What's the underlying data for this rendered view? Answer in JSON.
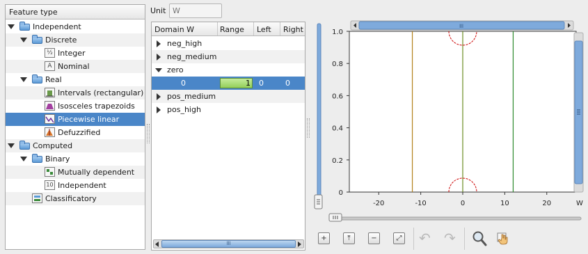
{
  "unit": {
    "label": "Unit",
    "placeholder": "W"
  },
  "tree": {
    "header": "Feature type",
    "items": [
      {
        "label": "Independent",
        "icon": "folder-icon"
      },
      {
        "label": "Discrete",
        "icon": "folder-icon"
      },
      {
        "label": "Integer",
        "icon": "integer-type-icon",
        "glyph": "½"
      },
      {
        "label": "Nominal",
        "icon": "nominal-type-icon",
        "glyph": "A"
      },
      {
        "label": "Real",
        "icon": "folder-icon"
      },
      {
        "label": "Intervals (rectangular)",
        "icon": "interval-type-icon"
      },
      {
        "label": "Isosceles trapezoids",
        "icon": "trapezoid-type-icon"
      },
      {
        "label": "Piecewise linear",
        "icon": "piecewise-linear-type-icon"
      },
      {
        "label": "Defuzzified",
        "icon": "defuzzified-type-icon"
      },
      {
        "label": "Computed",
        "icon": "folder-icon"
      },
      {
        "label": "Binary",
        "icon": "folder-icon"
      },
      {
        "label": "Mutually dependent",
        "icon": "mutually-dependent-icon"
      },
      {
        "label": "Independent",
        "icon": "binary-independent-icon",
        "glyph": "10"
      },
      {
        "label": "Classificatory",
        "icon": "classificatory-icon"
      }
    ],
    "selected": "Piecewise linear"
  },
  "table": {
    "columns": [
      "Domain W",
      "Range",
      "Left",
      "Right"
    ],
    "rows": [
      {
        "label": "neg_high"
      },
      {
        "label": "neg_medium"
      },
      {
        "label": "zero"
      },
      {
        "domain": "0",
        "range": "1",
        "left": "0",
        "right": "0"
      },
      {
        "label": "pos_medium"
      },
      {
        "label": "pos_high"
      }
    ],
    "scroll_grip": "lll"
  },
  "chart_data": {
    "type": "line",
    "x_ticks": [
      "-20",
      "-10",
      "0",
      "10",
      "20"
    ],
    "y_ticks": [
      "0",
      "0.2",
      "0.4",
      "0.6",
      "0.8",
      "1.0"
    ],
    "x_unit": "W",
    "xlim": [
      -27,
      27
    ],
    "ylim": [
      0,
      1
    ],
    "vertical_lines": [
      {
        "x": -12,
        "color": "#b3801a"
      },
      {
        "x": 0,
        "color": "#6b8e23"
      },
      {
        "x": 12,
        "color": "#2e8b2e"
      }
    ],
    "highlight_markers": [
      {
        "x": 0,
        "y": 1.0,
        "color": "#cc0000"
      },
      {
        "x": 0,
        "y": 0,
        "color": "#cc0000"
      }
    ],
    "scroll_grip": "lll"
  },
  "toolbar": {
    "buttons": [
      {
        "name": "add-point-button",
        "icon": "plus-icon"
      },
      {
        "name": "insert-point-button",
        "icon": "insert-icon"
      },
      {
        "name": "remove-point-button",
        "icon": "minus-icon"
      },
      {
        "name": "fit-view-button",
        "icon": "fit-icon"
      },
      {
        "name": "undo-button",
        "icon": "undo-icon"
      },
      {
        "name": "redo-button",
        "icon": "redo-icon"
      },
      {
        "name": "zoom-button",
        "icon": "magnifier-icon"
      },
      {
        "name": "pan-button",
        "icon": "hand-icon"
      }
    ]
  },
  "colors": {
    "selection": "#4a86c8",
    "scrollbar": "#7eaadc",
    "range_cell": "#a8db72"
  }
}
